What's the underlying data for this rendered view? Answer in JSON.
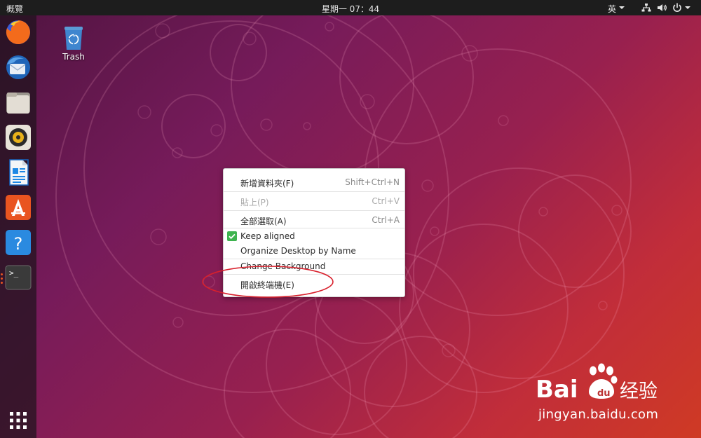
{
  "topbar": {
    "activities_label": "概覽",
    "clock": "星期一 07：44",
    "input_method": "英"
  },
  "dock": {
    "apps": [
      {
        "name": "Firefox",
        "icon": "firefox-icon"
      },
      {
        "name": "Thunderbird",
        "icon": "thunderbird-icon"
      },
      {
        "name": "Files",
        "icon": "files-icon"
      },
      {
        "name": "Rhythmbox",
        "icon": "rhythmbox-icon"
      },
      {
        "name": "LibreOffice Writer",
        "icon": "libreoffice-writer-icon"
      },
      {
        "name": "Ubuntu Software",
        "icon": "software-icon"
      },
      {
        "name": "Help",
        "icon": "help-icon"
      },
      {
        "name": "Terminal",
        "icon": "terminal-icon",
        "running": true
      }
    ],
    "show_apps_icon": "apps-grid-icon"
  },
  "desktop": {
    "trash_label": "Trash"
  },
  "context_menu": {
    "items": [
      {
        "label": "新增資料夾(F)",
        "accel": "Shift+Ctrl+N",
        "enabled": true
      },
      {
        "label": "貼上(P)",
        "accel": "Ctrl+V",
        "enabled": false
      },
      {
        "label": "全部選取(A)",
        "accel": "Ctrl+A",
        "enabled": true
      },
      {
        "label": "Keep aligned",
        "checked": true,
        "enabled": true
      },
      {
        "label": "Organize Desktop by Name",
        "enabled": true
      },
      {
        "label": "Change Background",
        "enabled": true
      },
      {
        "label": "開啟終端機(E)",
        "enabled": true,
        "highlighted_by_annotation": true
      }
    ]
  },
  "watermark": {
    "url": "jingyan.baidu.com"
  },
  "colors": {
    "topbar": "#1d1d1d",
    "accent": "#e95420",
    "check": "#3eb34f",
    "annotation": "#d8202c"
  }
}
